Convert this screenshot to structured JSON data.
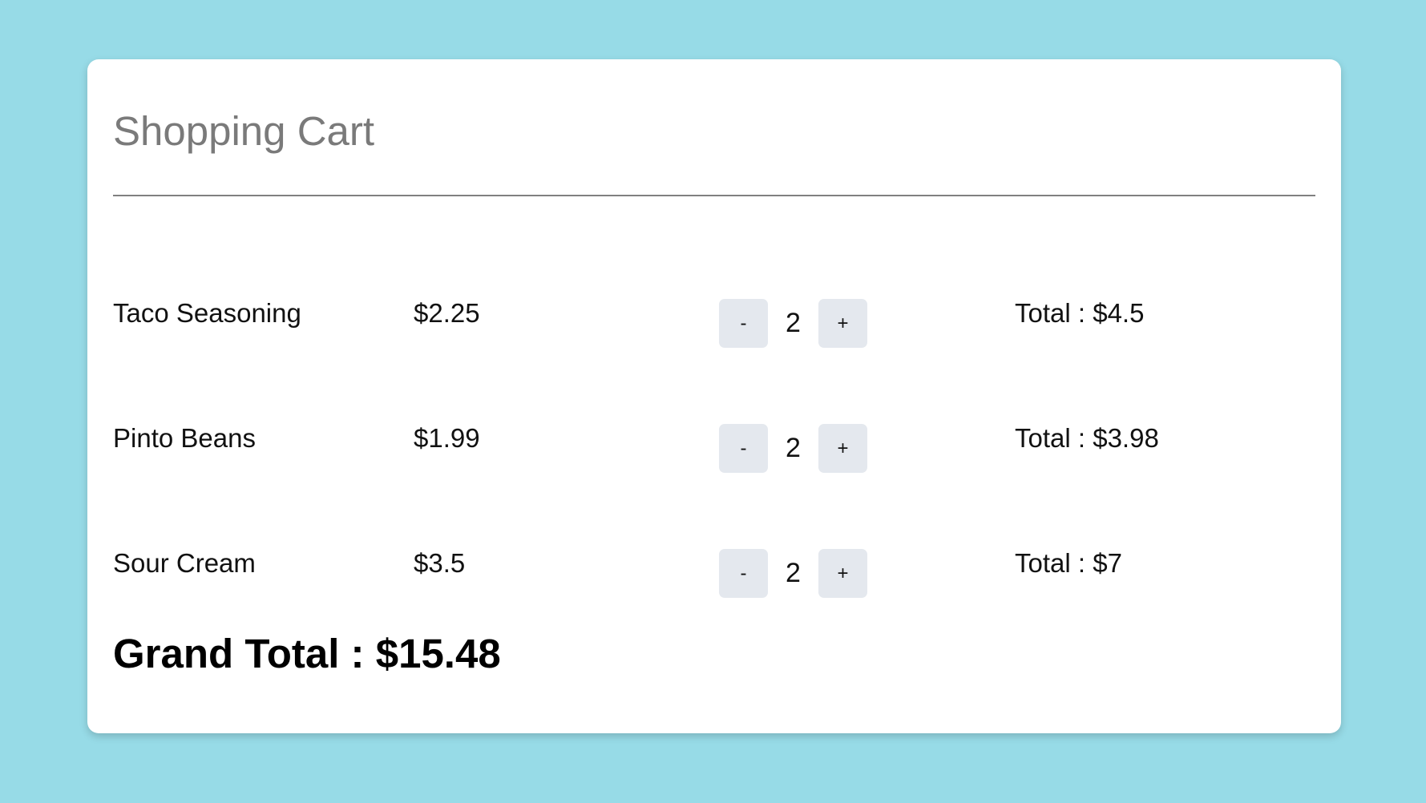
{
  "page": {
    "background_color": "#97dbe7",
    "card_color": "#ffffff"
  },
  "cart": {
    "title": "Shopping Cart",
    "items": [
      {
        "name": "Taco Seasoning",
        "price": "$2.25",
        "quantity": "2",
        "total": "Total : $4.5"
      },
      {
        "name": "Pinto Beans",
        "price": "$1.99",
        "quantity": "2",
        "total": "Total : $3.98"
      },
      {
        "name": "Sour Cream",
        "price": "$3.5",
        "quantity": "2",
        "total": "Total : $7"
      }
    ],
    "decrement_label": "-",
    "increment_label": "+",
    "grand_total": "Grand Total : $15.48"
  }
}
